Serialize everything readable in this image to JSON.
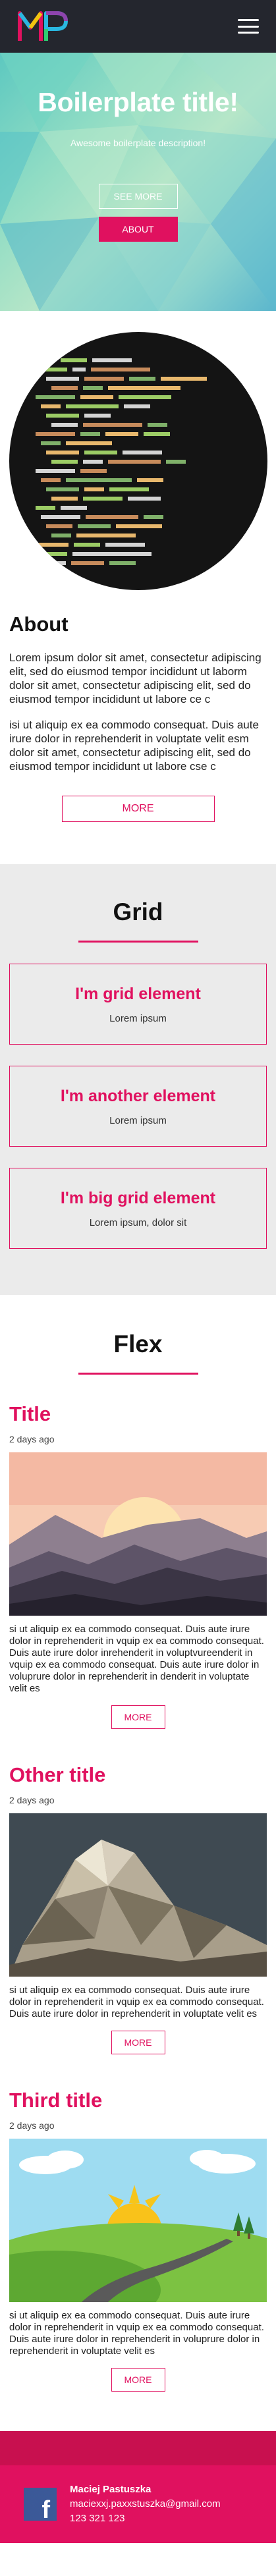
{
  "header": {
    "logo_icon": "mp-logo",
    "menu_icon": "hamburger-icon"
  },
  "hero": {
    "title": "Boilerplate title!",
    "description": "Awesome boilerplate description!",
    "see_more_label": "SEE MORE",
    "about_label": "ABOUT"
  },
  "about": {
    "title": "About",
    "paragraph_1": "Lorem ipsum dolor sit amet, consectetur adipiscing elit, sed do eiusmod tempor incididunt ut laborm dolor sit amet, consectetur adipiscing elit, sed do eiusmod tempor incididunt ut labore ce c",
    "paragraph_2": "isi ut aliquip ex ea commodo consequat. Duis aute irure dolor in reprehenderit in voluptate velit esm dolor sit amet, consectetur adipiscing elit, sed do eiusmod tempor incididunt ut labore cse c",
    "more_label": "MORE"
  },
  "grid": {
    "title": "Grid",
    "items": [
      {
        "title": "I'm grid element",
        "text": "Lorem ipsum"
      },
      {
        "title": "I'm another element",
        "text": "Lorem ipsum"
      },
      {
        "title": "I'm big grid element",
        "text": "Lorem ipsum, dolor sit"
      }
    ]
  },
  "flex": {
    "title": "Flex",
    "items": [
      {
        "title": "Title",
        "date": "2 days ago",
        "image": "sunset-mountains",
        "text": "si ut aliquip ex ea commodo consequat. Duis aute irure dolor in reprehenderit in vquip ex ea commodo consequat. Duis aute irure dolor inrehenderit in voluptvureenderit in vquip ex ea commodo consequat. Duis aute irure dolor in voluprure dolor in reprehenderit in denderit in voluptate velit es",
        "more_label": "MORE"
      },
      {
        "title": "Other title",
        "date": "2 days ago",
        "image": "low-poly-mountain",
        "text": "si ut aliquip ex ea commodo consequat. Duis aute irure dolor in reprehenderit in vquip ex ea commodo consequat. Duis aute irure dolor in reprehenderit in voluptate velit es",
        "more_label": "MORE"
      },
      {
        "title": "Third title",
        "date": "2 days ago",
        "image": "sunny-landscape",
        "text": "si ut aliquip ex ea commodo consequat. Duis aute irure dolor in reprehenderit in vquip ex ea commodo consequat. Duis aute irure dolor in reprehenderit in voluprure dolor in reprehenderit in voluptate velit es",
        "more_label": "MORE"
      }
    ]
  },
  "footer": {
    "social_icon": "facebook-icon",
    "name": "Maciej Pastuszka",
    "email": "maciexxj.paxxstuszka@gmail.com",
    "phone": "123 321 123"
  },
  "colors": {
    "accent": "#e0115f",
    "nav_bg": "#24262e",
    "grid_bg": "#ebebeb",
    "footer_bg": "#c8104f",
    "facebook": "#3b5998"
  }
}
